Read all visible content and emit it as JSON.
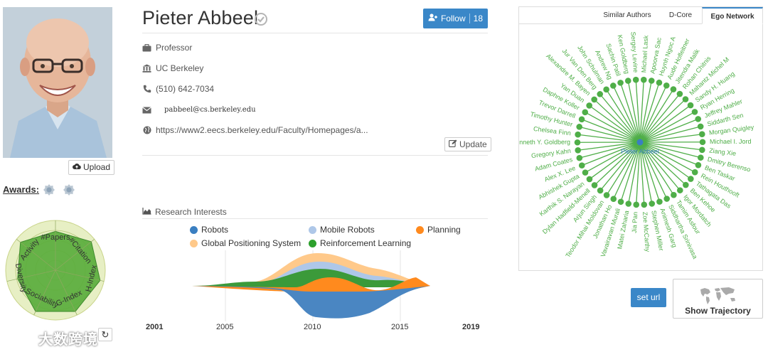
{
  "profile": {
    "name": "Pieter Abbeel",
    "title": "Professor",
    "affiliation": "UC Berkeley",
    "phone": "(510) 642-7034",
    "email": "pabbeel@cs.berkeley.edu",
    "homepage": "https://www2.eecs.berkeley.edu/Faculty/Homepages/a...",
    "photo": "portrait-photo"
  },
  "actions": {
    "follow_label": "Follow",
    "follow_count": "18",
    "update_label": "Update",
    "upload_label": "Upload",
    "set_url_label": "set url",
    "trajectory_label": "Show Trajectory"
  },
  "awards": {
    "label": "Awards:"
  },
  "radar": {
    "axes": [
      "#Papers",
      "#Citation",
      "H-Index",
      "G-Index",
      "Sociability",
      "Diversity",
      "Activity"
    ],
    "values": [
      0.78,
      0.92,
      0.92,
      0.92,
      0.92,
      0.78,
      0.9
    ],
    "colors": {
      "fill": "#5aad3c",
      "ring": "#e7efc4"
    }
  },
  "research": {
    "title": "Research Interests",
    "legend": [
      {
        "label": "Robots",
        "color": "#3a7fc1"
      },
      {
        "label": "Mobile Robots",
        "color": "#aec7e8"
      },
      {
        "label": "Planning",
        "color": "#ff8a1e"
      },
      {
        "label": "Global Positioning System",
        "color": "#ffc98a"
      },
      {
        "label": "Reinforcement Learning",
        "color": "#2ca02c"
      }
    ],
    "years": [
      "2001",
      "2005",
      "2010",
      "2015",
      "2019"
    ]
  },
  "ego": {
    "tabs": [
      "Similar Authors",
      "D-Core",
      "Ego Network"
    ],
    "active_tab": "Ego Network",
    "center": "Pieter Abbeel",
    "node_color": "#4fae48",
    "nodes": [
      "Michael Lask",
      "Apoorva Sac",
      "Huynh Ngoc A",
      "Aude Hofleitner",
      "Jitendra Malik",
      "Rohan Chitnis",
      "Mahantz Michel M",
      "Sandy H. Huang",
      "Ryan Herring",
      "Jeffrey Mahler",
      "Siddarth Sen",
      "Morgan Quigley",
      "Michael I. Jord",
      "Ziang Xie",
      "Dmitry Berenso",
      "Ben Taskar",
      "Rein Houthooft",
      "Tathagata Das",
      "Ben Kehoe",
      "Igor Mordatch",
      "Tamim Asfour",
      "Siddhartha Srinivasa",
      "Animesh Garg",
      "Stephen Miller",
      "Zoe McCarthy",
      "Jia Pan",
      "Matei Zaharia",
      "Vavairavan Murali",
      "Jonathan Ho",
      "Teodor Mihai Moldovan",
      "Arjun Singh",
      "Dylan Hadfield-Menell",
      "Karthik S. Narayan",
      "Abhishek Gupta",
      "Alex X. Lee",
      "Adam Coates",
      "Gregory Kahn",
      "Kenneth Y. Goldberg",
      "Chelsea Finn",
      "Timothy Hunter",
      "Trevor Darrell",
      "Daphne Koller",
      "Yan Duan",
      "Alexandre M. Bayen",
      "Jur Van Den Berg",
      "John Schulman",
      "Andrew Ng",
      "Sachin Patil",
      "Ken Goldberg",
      "Sergey Levine"
    ]
  },
  "watermark": "大数跨境"
}
